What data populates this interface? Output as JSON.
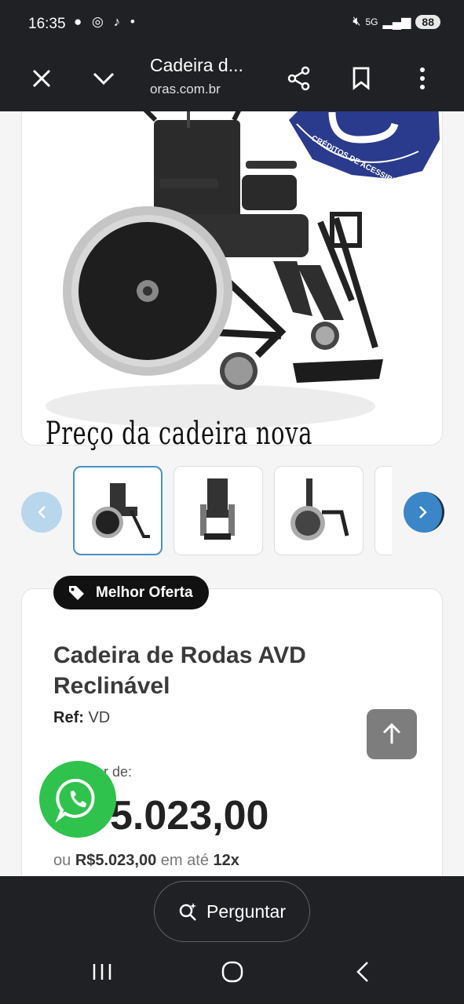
{
  "status": {
    "time": "16:35",
    "left_icons": [
      "chat-bubble-icon",
      "whatsapp-icon",
      "tiktok-icon",
      "dot-icon"
    ],
    "network": "5G",
    "battery": "88"
  },
  "toolbar": {
    "title": "Cadeira d...",
    "url": "oras.com.br"
  },
  "product": {
    "seal_text": "CRÉDITOS DE ACESSIBILIDADE",
    "caption": "Preço da cadeira nova",
    "badge": "Melhor Oferta",
    "title": "Cadeira de Rodas AVD Reclinável",
    "ref_label": "Ref:",
    "ref_value": "VD",
    "from_label": "r de:",
    "price": "5.023,00",
    "installment_prefix": "ou",
    "installment_price": "R$5.023,00",
    "installment_middle": "em até",
    "installment_count": "12x"
  },
  "bottom": {
    "ask_label": "Perguntar"
  },
  "colors": {
    "chrome": "#202124",
    "whatsapp": "#2fc24d",
    "carousel_prev": "#b8d6ec",
    "carousel_next": "#3b86c6",
    "seal": "#2a3a8c"
  }
}
